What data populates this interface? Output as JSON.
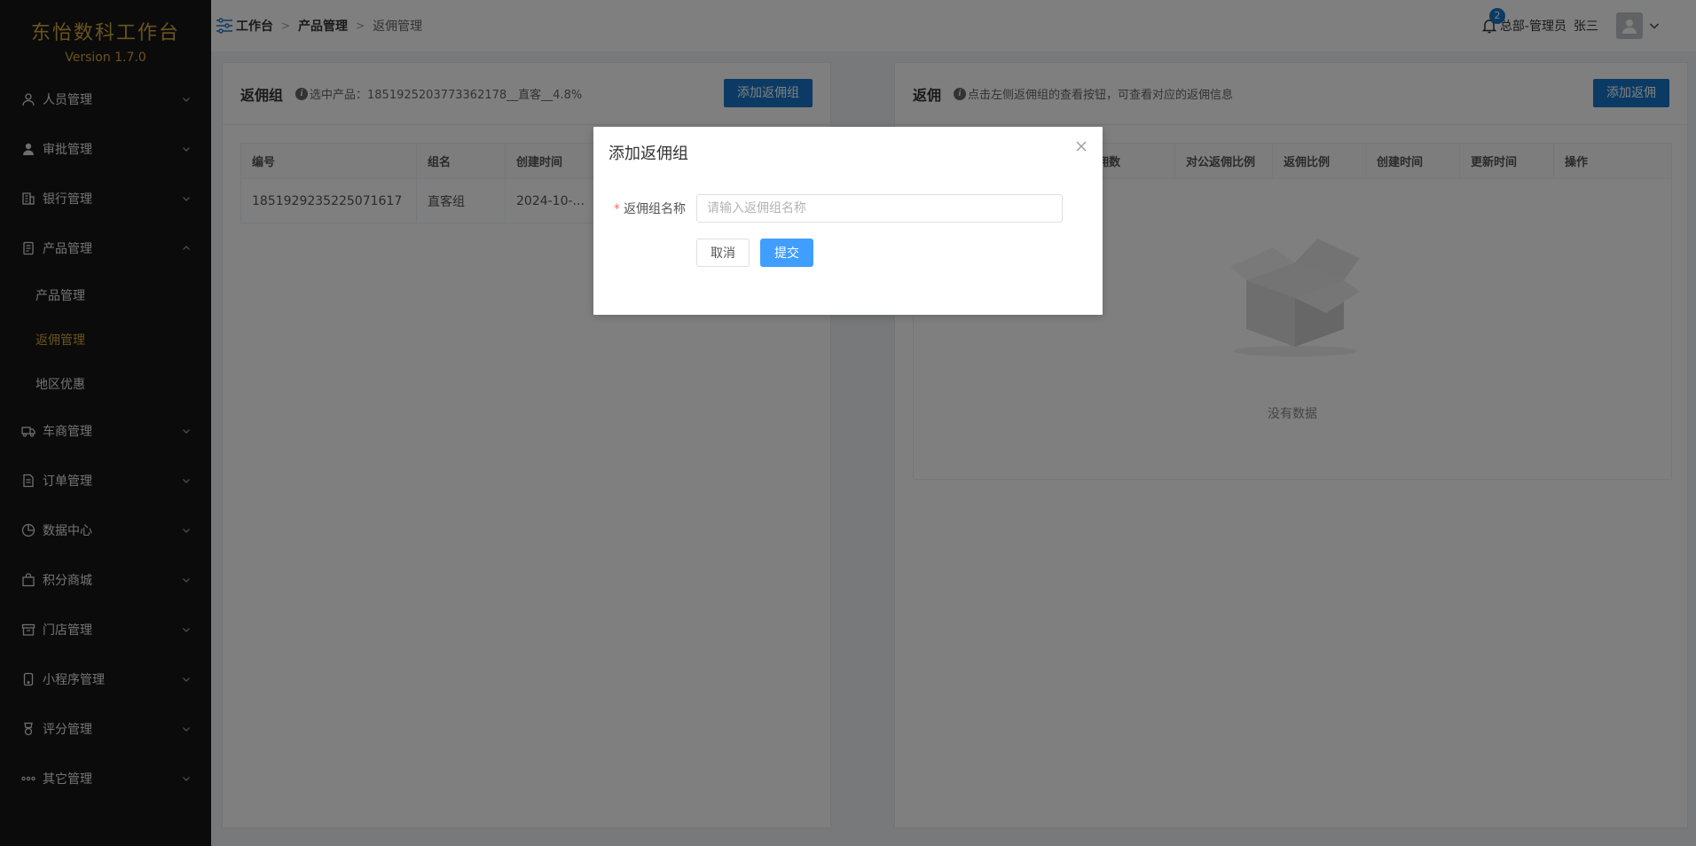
{
  "app": {
    "title": "东怡数科工作台",
    "version": "Version 1.7.0"
  },
  "sidebar": {
    "items": [
      {
        "label": "人员管理",
        "icon": "user-icon",
        "expanded": false
      },
      {
        "label": "审批管理",
        "icon": "approver-icon",
        "expanded": false
      },
      {
        "label": "银行管理",
        "icon": "bank-icon",
        "expanded": false
      },
      {
        "label": "产品管理",
        "icon": "document-icon",
        "expanded": true
      },
      {
        "label": "车商管理",
        "icon": "truck-icon",
        "expanded": false
      },
      {
        "label": "订单管理",
        "icon": "order-icon",
        "expanded": false
      },
      {
        "label": "数据中心",
        "icon": "pie-chart-icon",
        "expanded": false
      },
      {
        "label": "积分商城",
        "icon": "shopping-bag-icon",
        "expanded": false
      },
      {
        "label": "门店管理",
        "icon": "store-icon",
        "expanded": false
      },
      {
        "label": "小程序管理",
        "icon": "mobile-icon",
        "expanded": false
      },
      {
        "label": "评分管理",
        "icon": "medal-icon",
        "expanded": false
      },
      {
        "label": "其它管理",
        "icon": "more-icon",
        "expanded": false
      }
    ],
    "product_submenu": [
      {
        "label": "产品管理",
        "active": false
      },
      {
        "label": "返佣管理",
        "active": true
      },
      {
        "label": "地区优惠",
        "active": false
      }
    ]
  },
  "header": {
    "breadcrumb": [
      "工作台",
      "产品管理",
      "返佣管理"
    ],
    "notification_count": "2",
    "user_role": "总部-管理员",
    "user_name": "张三"
  },
  "left_panel": {
    "title": "返佣组",
    "hint": "选中产品：1851925203773362178__直客__4.8%",
    "add_button": "添加返佣组",
    "columns": [
      "编号",
      "组名",
      "创建时间"
    ],
    "rows": [
      {
        "id": "1851929235225071617",
        "name": "直客组",
        "created": "2024-10-..."
      }
    ]
  },
  "right_panel": {
    "title": "返佣",
    "hint": "点击左侧返佣组的查看按钮，可查看对应的返佣信息",
    "add_button": "添加返佣",
    "columns": [
      "",
      "佣数",
      "对公返佣比例",
      "返佣比例",
      "创建时间",
      "更新时间",
      "操作"
    ],
    "empty_text": "没有数据"
  },
  "modal": {
    "title": "添加返佣组",
    "field_label": "返佣组名称",
    "field_placeholder": "请输入返佣组名称",
    "field_value": "",
    "cancel_label": "取消",
    "submit_label": "提交"
  },
  "colors": {
    "brand_gold": "#d4a63c",
    "sidebar_bg": "#171717",
    "primary_blue": "#1677c9",
    "submit_blue": "#409eff"
  }
}
